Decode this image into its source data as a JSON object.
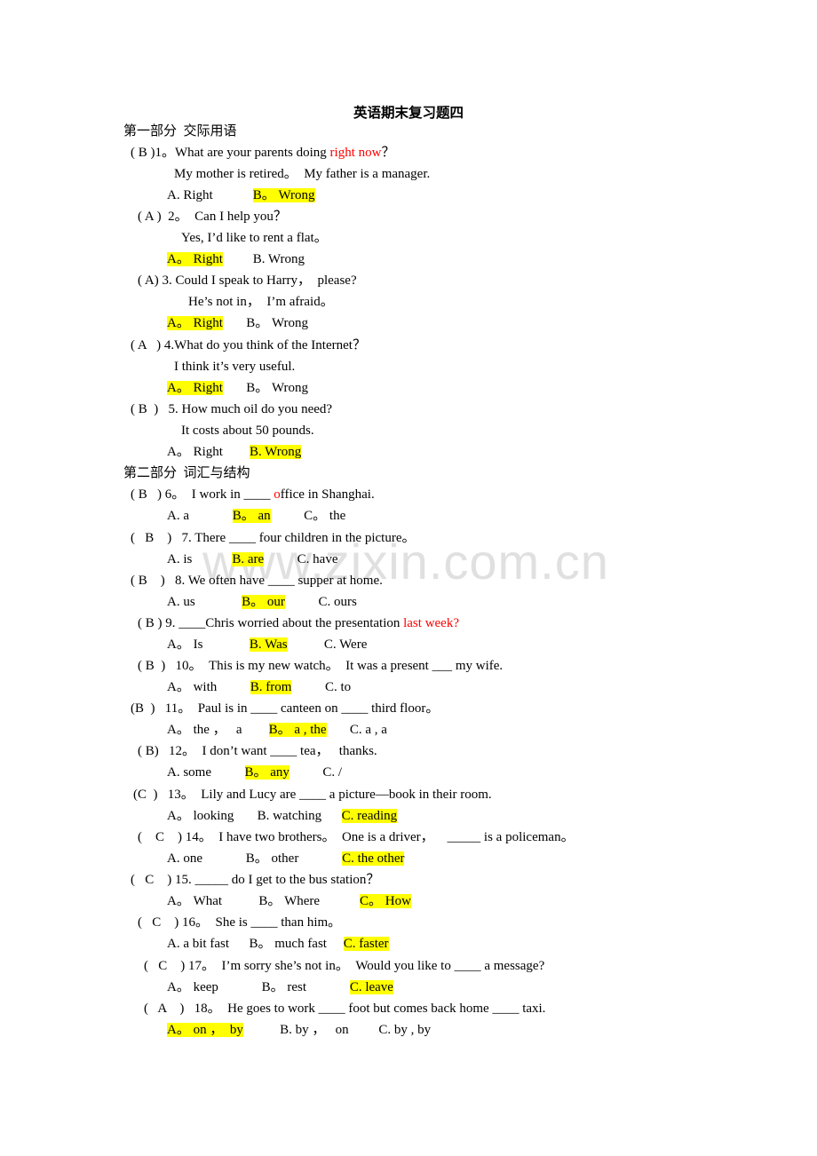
{
  "title": "英语期末复习题四",
  "watermark": "www.zixin.com.cn",
  "colors": {
    "highlight": "#ffff00",
    "emphasis": "#ff0000"
  },
  "sections": [
    {
      "heading": "第一部分  交际用语"
    },
    {
      "heading": "第二部分  词汇与结构"
    }
  ],
  "lines": [
    {
      "parts": [
        {
          "t": "( B )1。What are your parents doing "
        },
        {
          "t": "right now",
          "red": true
        },
        {
          "t": "？"
        }
      ]
    },
    {
      "parts": [
        {
          "t": "My mother is retired。  My father is a manager."
        }
      ]
    },
    {
      "parts": [
        {
          "t": "A. Right"
        },
        {
          "t": "            "
        },
        {
          "t": "B。 Wrong",
          "hl": true
        }
      ]
    },
    {
      "parts": [
        {
          "t": "( A )  2。  Can I help you？"
        }
      ]
    },
    {
      "parts": [
        {
          "t": "Yes, I’d like to rent a flat。"
        }
      ]
    },
    {
      "parts": [
        {
          "t": "A。 Right",
          "hl": true
        },
        {
          "t": "         B. Wrong"
        }
      ]
    },
    {
      "parts": [
        {
          "t": "( A) 3. Could I speak to Harry，  please?"
        }
      ]
    },
    {
      "parts": [
        {
          "t": "He’s not in，  I’m afraid。"
        }
      ]
    },
    {
      "parts": [
        {
          "t": "A。 Right",
          "hl": true
        },
        {
          "t": "       B。 Wrong"
        }
      ]
    },
    {
      "parts": [
        {
          "t": "( A   ) 4.What do you think of the Internet？"
        }
      ]
    },
    {
      "parts": [
        {
          "t": "I think it’s very useful."
        }
      ]
    },
    {
      "parts": [
        {
          "t": "A。 Right",
          "hl": true
        },
        {
          "t": "       B。 Wrong"
        }
      ]
    },
    {
      "parts": [
        {
          "t": "( B  )   5. How much oil do you need?"
        }
      ]
    },
    {
      "parts": [
        {
          "t": "It costs about 50 pounds."
        }
      ]
    },
    {
      "parts": [
        {
          "t": "A。 Right        "
        },
        {
          "t": "B. Wrong",
          "hl": true
        }
      ]
    },
    {
      "parts": [
        {
          "t": "( B   ) 6。  I work in ____ "
        },
        {
          "t": "o",
          "red": true
        },
        {
          "t": "ffice in Shanghai."
        }
      ]
    },
    {
      "parts": [
        {
          "t": "A. a             "
        },
        {
          "t": "B。 an",
          "hl": true
        },
        {
          "t": "          C。 the"
        }
      ]
    },
    {
      "parts": [
        {
          "t": "(   B    )   7. There ____ four children in the picture。"
        }
      ]
    },
    {
      "parts": [
        {
          "t": "A. is            "
        },
        {
          "t": "B. are",
          "hl": true
        },
        {
          "t": "          C. have"
        }
      ]
    },
    {
      "parts": [
        {
          "t": "( B    )   8. We often have ____ supper at home."
        }
      ]
    },
    {
      "parts": [
        {
          "t": "A. us              "
        },
        {
          "t": "B。 our",
          "hl": true
        },
        {
          "t": "          C. ours"
        }
      ]
    },
    {
      "parts": [
        {
          "t": "( B ) 9. ____Chris worried about the presentation "
        },
        {
          "t": "last week?",
          "red": true
        }
      ]
    },
    {
      "parts": [
        {
          "t": "A。 Is              "
        },
        {
          "t": "B. Was",
          "hl": true
        },
        {
          "t": "           C. Were"
        }
      ]
    },
    {
      "parts": [
        {
          "t": "( B  )   10。  This is my new watch。  It was a present ___ my wife."
        }
      ]
    },
    {
      "parts": [
        {
          "t": "A。 with          "
        },
        {
          "t": "B. from",
          "hl": true
        },
        {
          "t": "          C. to"
        }
      ]
    },
    {
      "parts": [
        {
          "t": "(B  )   11。  Paul is in ____ canteen on ____ third floor。"
        }
      ]
    },
    {
      "parts": [
        {
          "t": "A。 the ，   a        "
        },
        {
          "t": "B。 a , the",
          "hl": true
        },
        {
          "t": "       C. a , a"
        }
      ]
    },
    {
      "parts": [
        {
          "t": "( B)   12。  I don’t want ____ tea，   thanks."
        }
      ]
    },
    {
      "parts": [
        {
          "t": "A. some          "
        },
        {
          "t": "B。 any",
          "hl": true
        },
        {
          "t": "          C. /"
        }
      ]
    },
    {
      "parts": [
        {
          "t": "(C  )   13。  Lily and Lucy are ____ a picture—book in their room."
        }
      ]
    },
    {
      "parts": [
        {
          "t": "A。 looking       B. watching      "
        },
        {
          "t": "C. reading",
          "hl": true
        }
      ]
    },
    {
      "parts": [
        {
          "t": "(    C    ) 14。  I have two brothers。  One is a driver，    _____ is a policeman。"
        }
      ]
    },
    {
      "parts": [
        {
          "t": "A. one             B。 other             "
        },
        {
          "t": "C. the other",
          "hl": true
        }
      ]
    },
    {
      "parts": [
        {
          "t": "(   C    ) 15. _____ do I get to the bus station？"
        }
      ]
    },
    {
      "parts": [
        {
          "t": "A。 What           B。 Where            "
        },
        {
          "t": "C。 How",
          "hl": true
        }
      ]
    },
    {
      "parts": [
        {
          "t": "(   C    ) 16。  She is ____ than him。"
        }
      ]
    },
    {
      "parts": [
        {
          "t": "A. a bit fast      B。 much fast     "
        },
        {
          "t": "C. faster",
          "hl": true
        }
      ]
    },
    {
      "parts": [
        {
          "t": "(   C    ) 17。  I’m sorry she’s not in。  Would you like to ____ a message?"
        }
      ]
    },
    {
      "parts": [
        {
          "t": "A。 keep             B。 rest             "
        },
        {
          "t": "C. leave",
          "hl": true
        }
      ]
    },
    {
      "parts": [
        {
          "t": "(   A    )   18。  He goes to work ____ foot but comes back home ____ taxi."
        }
      ]
    },
    {
      "parts": [
        {
          "t": "A。 on ，  by",
          "hl": true
        },
        {
          "t": "           B. by ，   on         C. by , by"
        }
      ]
    }
  ]
}
